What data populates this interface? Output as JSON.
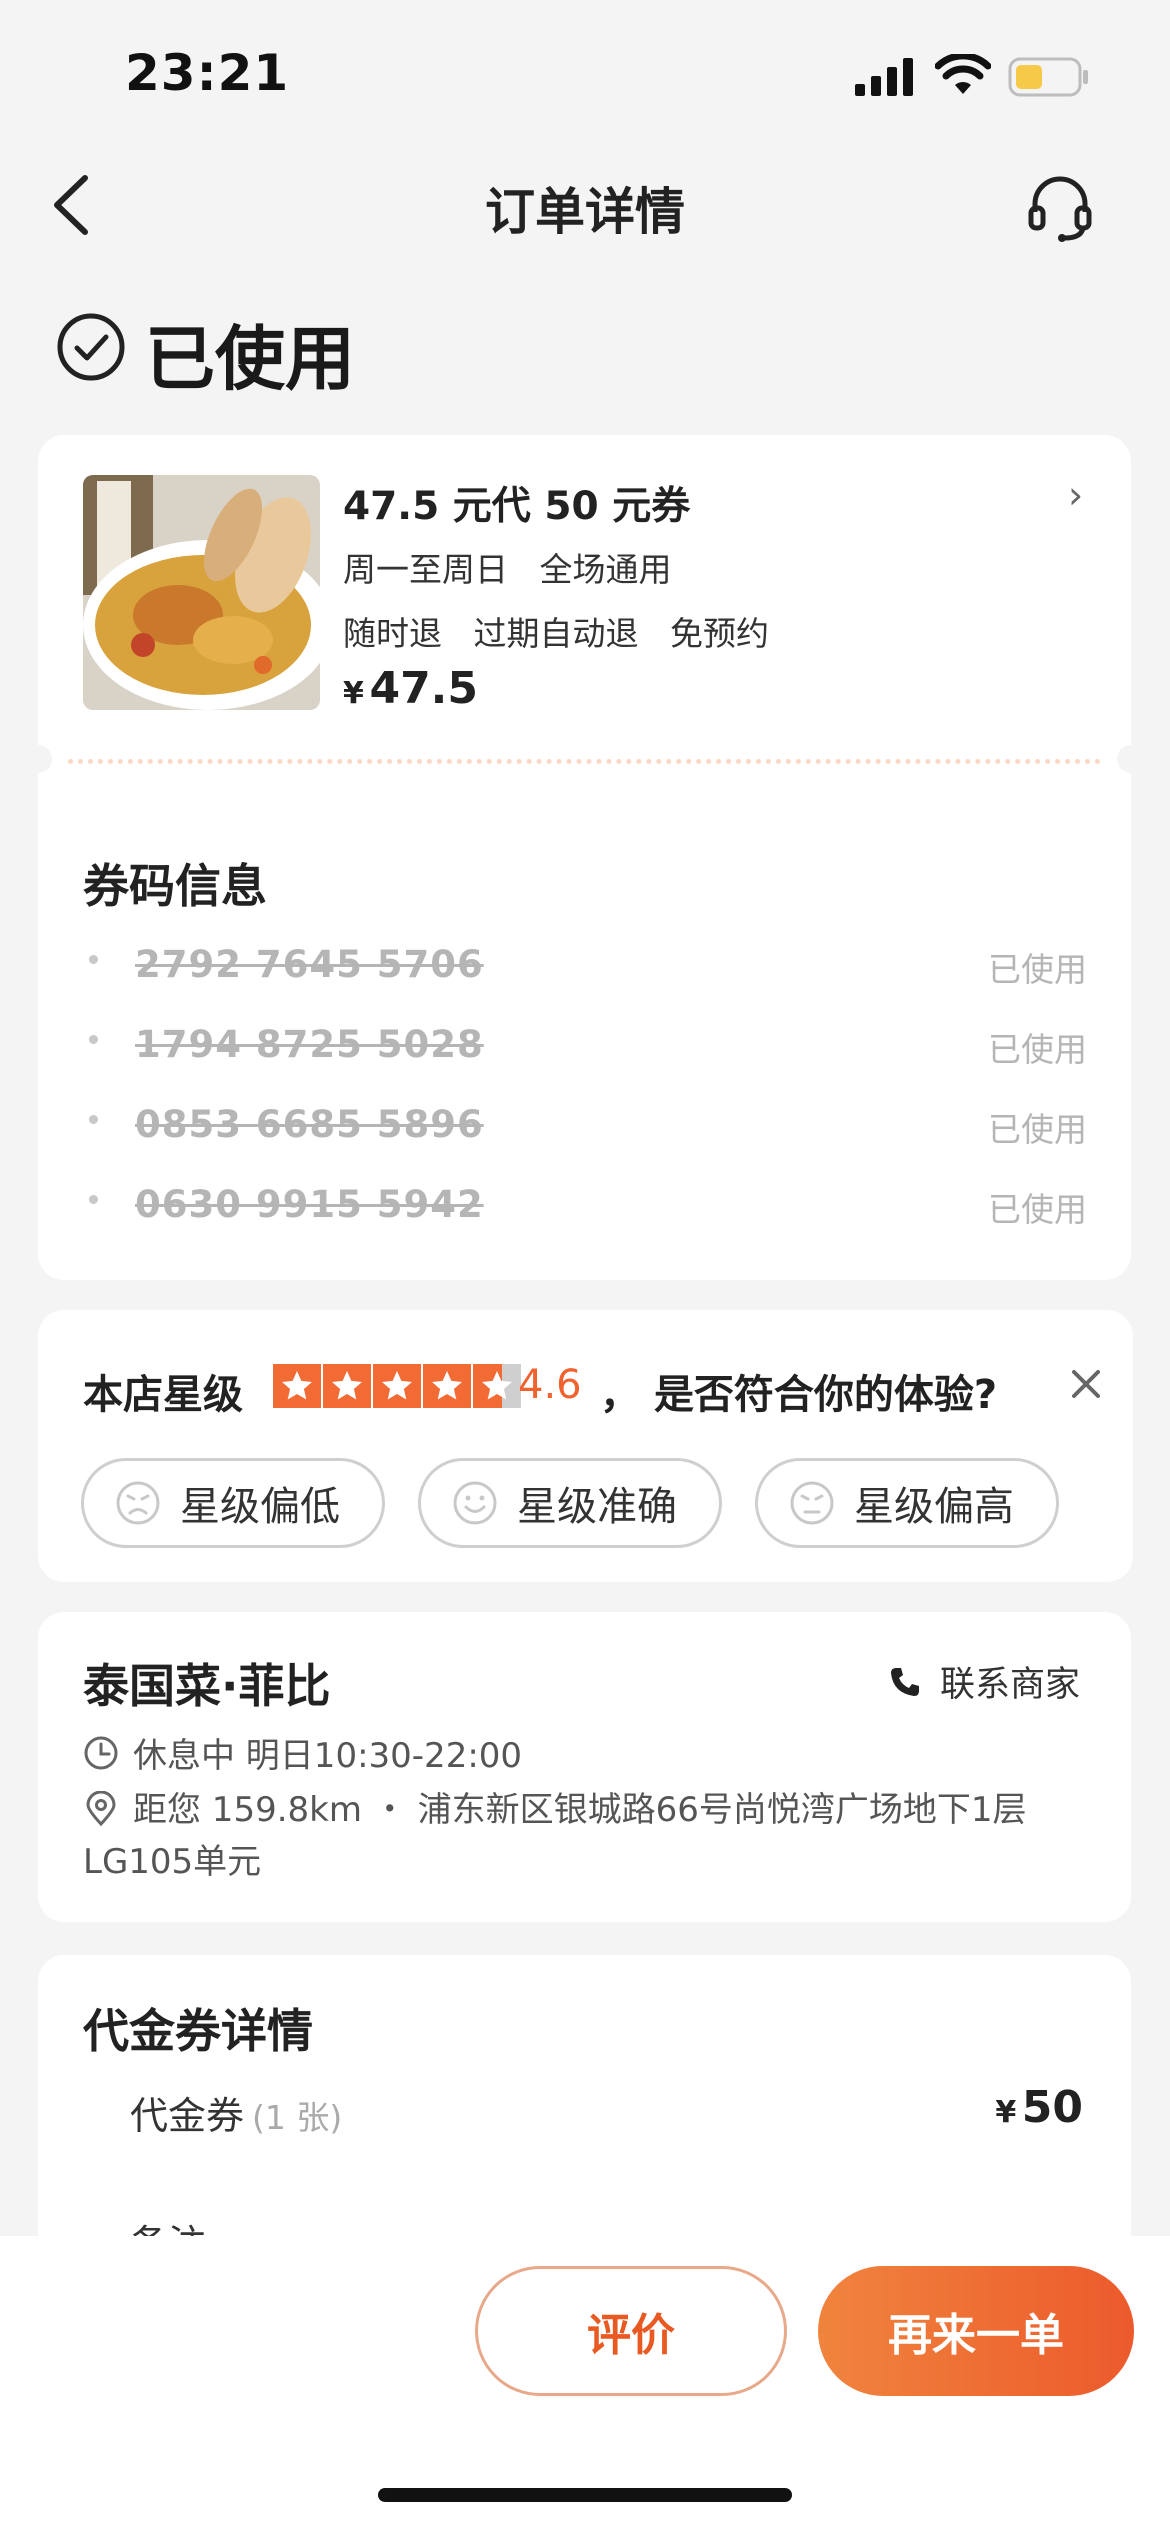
{
  "status_bar": {
    "time": "23:21",
    "battery_color": "#f7c948"
  },
  "nav": {
    "title": "订单详情",
    "back_icon": "chevron-left-icon",
    "support_icon": "headset-icon"
  },
  "order_status": {
    "text": "已使用",
    "icon": "check-circle-icon"
  },
  "product": {
    "title": "47.5 元代 50 元券",
    "line1": "周一至周日   全场通用",
    "line2": "随时退   过期自动退   免预约",
    "currency": "¥",
    "price": "47.5"
  },
  "codes": {
    "title": "券码信息",
    "items": [
      {
        "code": "2792 7645 5706",
        "status": "已使用"
      },
      {
        "code": "1794 8725 5028",
        "status": "已使用"
      },
      {
        "code": "0853 6685 5896",
        "status": "已使用"
      },
      {
        "code": "0630 9915 5942",
        "status": "已使用"
      }
    ]
  },
  "rating": {
    "label": "本店星级",
    "score": "4.6",
    "stars_value": 4.6,
    "separator": "，",
    "question": "是否符合你的体验?",
    "accent": "#f26b35",
    "options": [
      "星级偏低",
      "星级准确",
      "星级偏高"
    ]
  },
  "shop": {
    "name": "泰国菜·菲比",
    "contact": "联系商家",
    "hours": "休息中 明日10:30-22:00",
    "address": "距您 159.8km ・ 浦东新区银城路66号尚悦湾广场地下1层LG105单元"
  },
  "voucher": {
    "title": "代金券详情",
    "item": "代金券",
    "count": "(1 张)",
    "currency": "¥",
    "price": "50",
    "note": "备注"
  },
  "actions": {
    "review": "评价",
    "again": "再来一单",
    "accent": "#ec5a2c"
  }
}
